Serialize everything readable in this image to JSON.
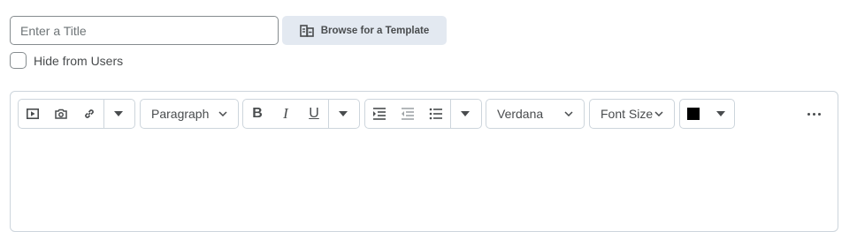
{
  "title_input": {
    "placeholder": "Enter a Title",
    "value": ""
  },
  "browse_button": {
    "label": "Browse for a Template",
    "icon": "template-icon"
  },
  "hide_checkbox": {
    "label": "Hide from Users",
    "checked": false
  },
  "toolbar": {
    "insert_group": [
      "video-icon",
      "camera-icon",
      "link-icon",
      "caret-down-icon"
    ],
    "format_dropdown": {
      "selected": "Paragraph"
    },
    "style_group": {
      "bold": "B",
      "italic": "I",
      "underline": "U"
    },
    "list_group": [
      "indent-icon",
      "outdent-icon",
      "bullet-list-icon",
      "caret-down-icon"
    ],
    "font_family_dropdown": {
      "selected": "Verdana"
    },
    "font_size_dropdown": {
      "selected": "Font Size"
    },
    "color_picker": {
      "color": "#000000"
    },
    "more_icon": "ellipsis-icon"
  },
  "colors": {
    "accent_bg": "#e3e9f1",
    "border": "#cdd5dc",
    "text": "#494c4e"
  }
}
